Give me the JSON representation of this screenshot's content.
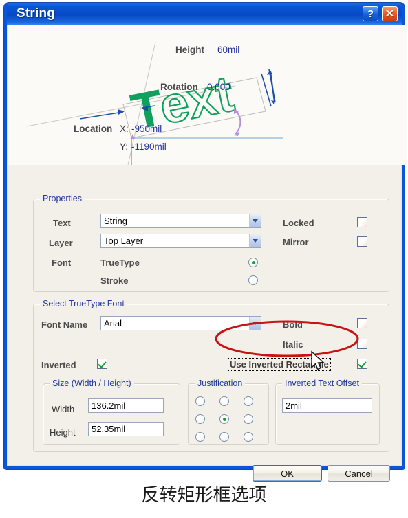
{
  "window": {
    "title": "String",
    "help_button": "?",
    "close_button": "✕"
  },
  "preview": {
    "sample_text": "Text",
    "height_label": "Height",
    "height_value": "60mil",
    "rotation_label": "Rotation",
    "rotation_value": "0.000",
    "location_label": "Location",
    "location_x_label": "X:",
    "location_x_value": "-950mil",
    "location_y_label": "Y:",
    "location_y_value": "-1190mil"
  },
  "properties": {
    "legend": "Properties",
    "text_label": "Text",
    "text_value": "String",
    "layer_label": "Layer",
    "layer_value": "Top Layer",
    "font_label": "Font",
    "truetype_label": "TrueType",
    "stroke_label": "Stroke",
    "font_selected": "TrueType",
    "locked_label": "Locked",
    "locked_checked": false,
    "mirror_label": "Mirror",
    "mirror_checked": false
  },
  "truetype": {
    "legend": "Select TrueType Font",
    "font_name_label": "Font Name",
    "font_name_value": "Arial",
    "bold_label": "Bold",
    "bold_checked": false,
    "italic_label": "Italic",
    "italic_checked": false,
    "inverted_label": "Inverted",
    "inverted_checked": true,
    "use_inverted_rect_label": "Use Inverted Rectangle",
    "use_inverted_rect_checked": true
  },
  "size": {
    "legend": "Size (Width / Height)",
    "width_label": "Width",
    "width_value": "136.2mil",
    "height_label": "Height",
    "height_value": "52.35mil"
  },
  "justification": {
    "legend": "Justification",
    "selected_index": 4,
    "cells": [
      "top-left",
      "top-center",
      "top-right",
      "middle-left",
      "middle-center",
      "middle-right",
      "bottom-left",
      "bottom-center",
      "bottom-right"
    ]
  },
  "offset": {
    "legend": "Inverted Text Offset",
    "value": "2mil"
  },
  "buttons": {
    "ok": "OK",
    "cancel": "Cancel"
  },
  "caption": "反转矩形框选项",
  "colors": {
    "titlebar_blue": "#0a56d4",
    "dialog_face": "#f2f0e9",
    "legend_blue": "#23389c",
    "preview_green": "#12a05e",
    "dimension_blue": "#1d4fa8",
    "rotation_purple": "#b08fe0",
    "value_navy": "#22309a",
    "annotation_red": "#c81414",
    "check_green": "#1a9a34",
    "radio_green": "#17a032"
  }
}
